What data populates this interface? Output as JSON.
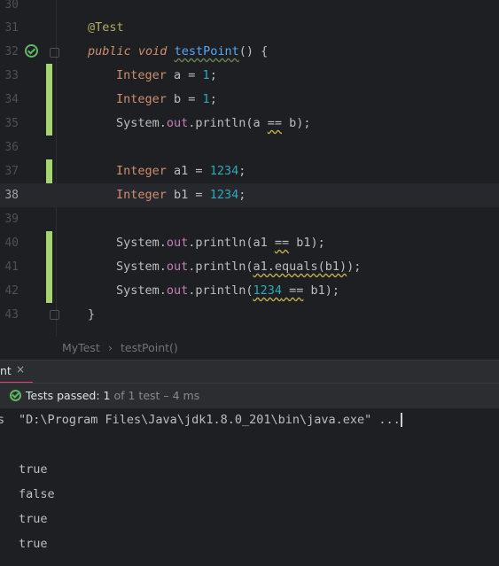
{
  "editor": {
    "lines": [
      {
        "num": "30",
        "text": ""
      },
      {
        "num": "31",
        "text": "@Test"
      },
      {
        "num": "32",
        "text": "public void testPoint() {"
      },
      {
        "num": "33",
        "text": "Integer a = 1;"
      },
      {
        "num": "34",
        "text": "Integer b = 1;"
      },
      {
        "num": "35",
        "text": "System.out.println(a == b);"
      },
      {
        "num": "36",
        "text": ""
      },
      {
        "num": "37",
        "text": "Integer a1 = 1234;"
      },
      {
        "num": "38",
        "text": "Integer b1 = 1234;"
      },
      {
        "num": "39",
        "text": ""
      },
      {
        "num": "40",
        "text": "System.out.println(a1 == b1);"
      },
      {
        "num": "41",
        "text": "System.out.println(a1.equals(b1));"
      },
      {
        "num": "42",
        "text": "System.out.println(1234 == b1);"
      },
      {
        "num": "43",
        "text": "}"
      }
    ],
    "tokens": {
      "annotation": "@Test",
      "kw_public": "public",
      "kw_void": "void",
      "method": "testPoint",
      "paren_open": "() {",
      "type": "Integer",
      "system": "System.",
      "out": "out",
      "println": ".println(",
      "close_brace": "}"
    },
    "current_line": "38",
    "colors": {
      "keyword": "#cf8e6d",
      "number": "#2aacb8",
      "field": "#c77dbb",
      "method": "#56a8f5",
      "annotation": "#b3ae60",
      "change_marker": "#a6d56e"
    }
  },
  "breadcrumb": {
    "items": [
      "MyTest",
      "testPoint()"
    ],
    "separator": "›"
  },
  "run_panel": {
    "tab_label": "nt",
    "tab_close": "×",
    "status": {
      "prefix": "Tests passed:",
      "count": "1",
      "suffix": "of 1 test – 4 ms"
    },
    "console": {
      "side_label": "s",
      "command": "\"D:\\Program Files\\Java\\jdk1.8.0_201\\bin\\java.exe\" ...",
      "output": [
        "true",
        "false",
        "true",
        "true"
      ]
    }
  }
}
